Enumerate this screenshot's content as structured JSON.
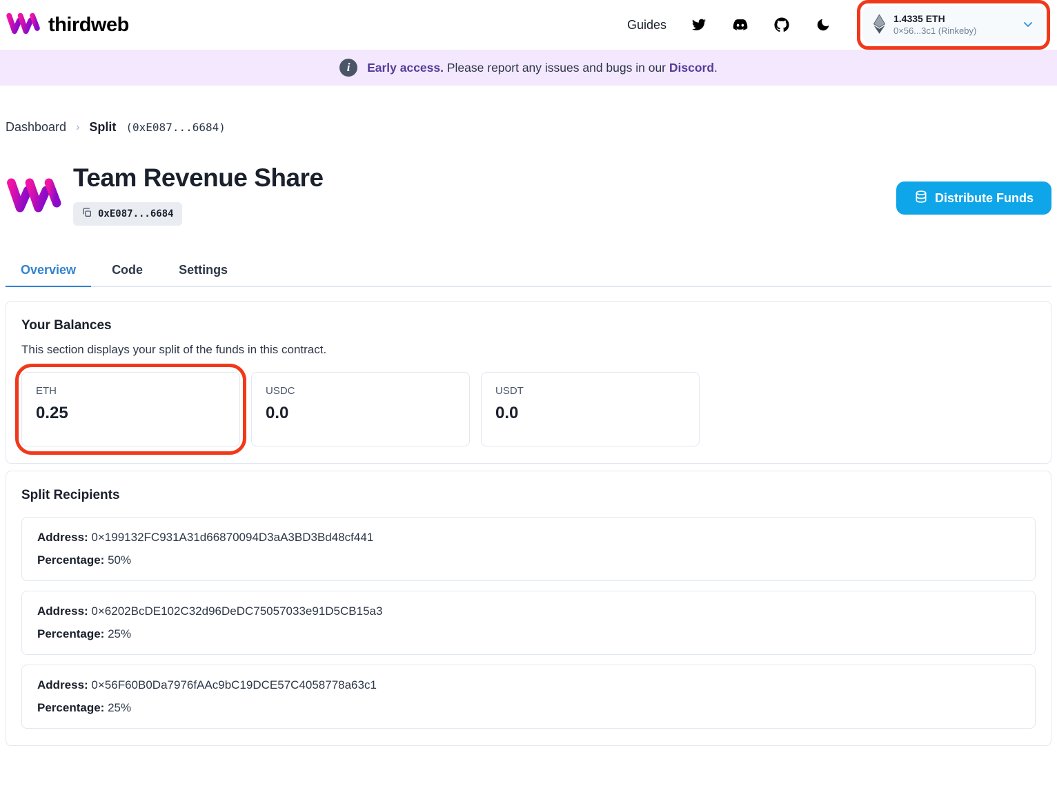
{
  "navbar": {
    "brand": "thirdweb",
    "guides_label": "Guides",
    "wallet": {
      "balance": "1.4335 ETH",
      "address": "0×56...3c1 (Rinkeby)"
    }
  },
  "banner": {
    "bold": "Early access.",
    "text": "Please report any issues and bugs in our",
    "link": "Discord",
    "suffix": "."
  },
  "breadcrumb": {
    "dashboard": "Dashboard",
    "current": "Split",
    "address": "(0xE087...6684)"
  },
  "header": {
    "title": "Team Revenue Share",
    "address_badge": "0xE087...6684",
    "distribute_button": "Distribute Funds"
  },
  "tabs": {
    "items": [
      {
        "label": "Overview",
        "active": true
      },
      {
        "label": "Code",
        "active": false
      },
      {
        "label": "Settings",
        "active": false
      }
    ]
  },
  "balances": {
    "title": "Your Balances",
    "description": "This section displays your split of the funds in this contract.",
    "items": [
      {
        "currency": "ETH",
        "value": "0.25",
        "highlighted": true
      },
      {
        "currency": "USDC",
        "value": "0.0",
        "highlighted": false
      },
      {
        "currency": "USDT",
        "value": "0.0",
        "highlighted": false
      }
    ]
  },
  "recipients": {
    "title": "Split Recipients",
    "address_label": "Address:",
    "percentage_label": "Percentage:",
    "items": [
      {
        "address": "0×199132FC931A31d66870094D3aA3BD3Bd48cf441",
        "percentage": "50%"
      },
      {
        "address": "0×6202BcDE102C32d96DeDC75057033e91D5CB15a3",
        "percentage": "25%"
      },
      {
        "address": "0×56F60B0Da7976fAAc9bC19DCE57C4058778a63c1",
        "percentage": "25%"
      }
    ]
  },
  "annotations": {
    "color": "#F0391B",
    "targets": [
      "wallet-button",
      "eth-balance-card"
    ]
  },
  "colors": {
    "button_blue": "#0EA5E9",
    "active_tab_blue": "#3182CE",
    "banner_background": "#F3E8FD"
  }
}
